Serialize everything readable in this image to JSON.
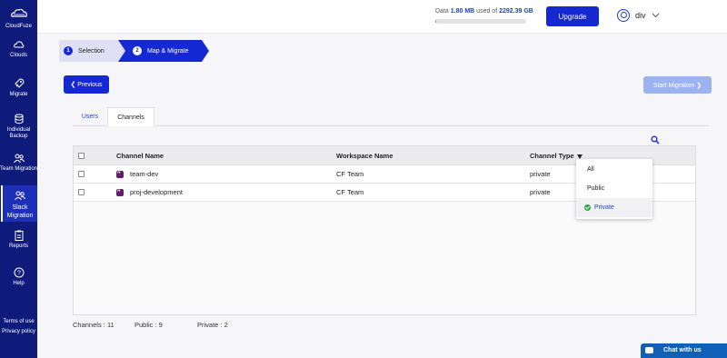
{
  "app": {
    "name": "CloudFuze"
  },
  "sidebar": {
    "items": [
      {
        "label": "Clouds",
        "icon": "cloud-icon"
      },
      {
        "label": "Migrate",
        "icon": "rocket-icon"
      },
      {
        "label": "Individual Backup",
        "icon": "database-icon"
      },
      {
        "label": "Team Migration",
        "icon": "users-icon"
      },
      {
        "label": "Slack Migration",
        "icon": "users-icon",
        "active": true
      },
      {
        "label": "Reports",
        "icon": "clipboard-icon"
      },
      {
        "label": "Help",
        "icon": "help-icon"
      }
    ],
    "footer": {
      "terms": "Terms of use",
      "privacy": "Privacy policy"
    }
  },
  "header": {
    "data_prefix": "Data",
    "data_used": "1.80 MB",
    "data_mid": "used of",
    "data_total": "2292.39 GB",
    "usage_fraction": 0.01,
    "upgrade_label": "Upgrade",
    "username": "div"
  },
  "stepper": {
    "steps": [
      {
        "number": "1",
        "label": "Selection"
      },
      {
        "number": "2",
        "label": "Map & Migrate"
      }
    ]
  },
  "actions": {
    "previous_label": "Previous",
    "start_label": "Start Migration"
  },
  "tabs": [
    {
      "label": "Users"
    },
    {
      "label": "Channels"
    }
  ],
  "table": {
    "headers": {
      "name": "Channel Name",
      "workspace": "Workspace Name",
      "type": "Channel Type"
    },
    "rows": [
      {
        "name": "team-dev",
        "workspace": "CF Team",
        "type": "private"
      },
      {
        "name": "proj-development",
        "workspace": "CF Team",
        "type": "private"
      }
    ]
  },
  "filter": {
    "options": [
      {
        "label": "All"
      },
      {
        "label": "Public"
      },
      {
        "label": "Private"
      }
    ],
    "selected": "Private"
  },
  "counts": {
    "channels": "Channels : 11",
    "public": "Public : 9",
    "private": "Private : 2"
  },
  "chat": {
    "label": "Chat with us"
  },
  "colors": {
    "primary": "#1429d3",
    "sidebar": "#0f1b7a",
    "slack": "#611f69",
    "check": "#2aa84a"
  }
}
